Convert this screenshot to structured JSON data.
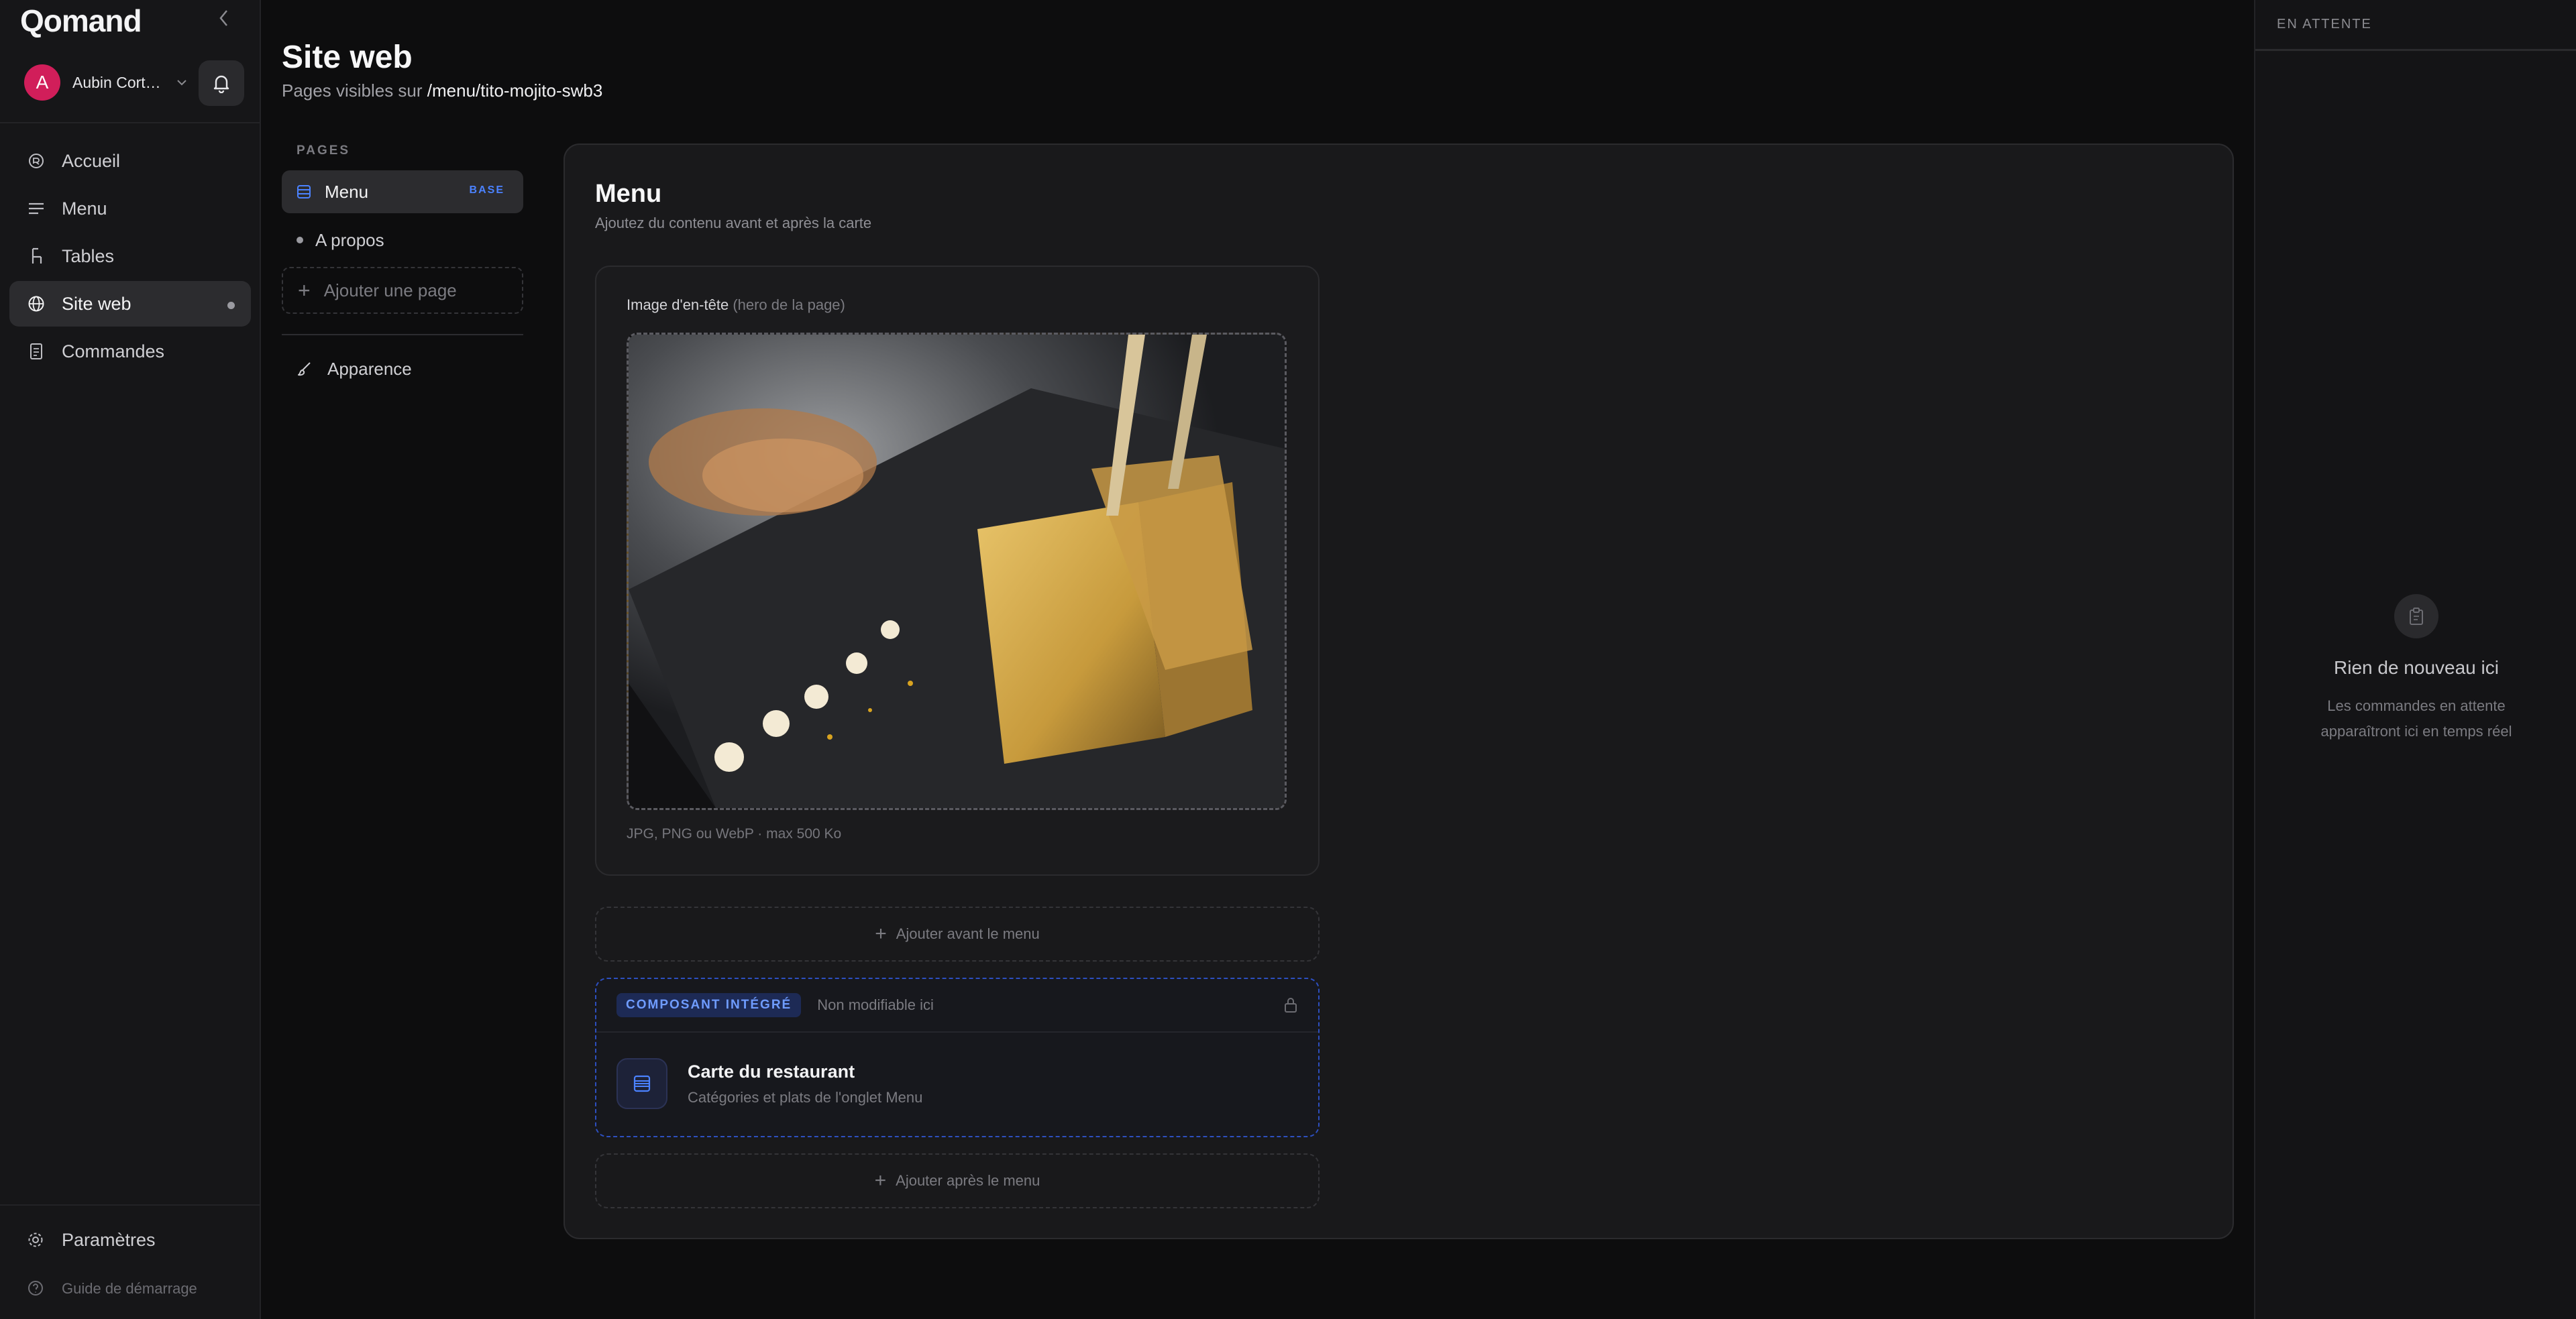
{
  "app": {
    "logo": "Qomand"
  },
  "user": {
    "initial": "A",
    "name": "Aubin Cort…"
  },
  "nav": {
    "items": [
      {
        "label": "Accueil",
        "icon": "home-circle-icon"
      },
      {
        "label": "Menu",
        "icon": "lines-icon"
      },
      {
        "label": "Tables",
        "icon": "chair-icon"
      },
      {
        "label": "Site web",
        "icon": "globe-icon"
      },
      {
        "label": "Commandes",
        "icon": "receipt-icon"
      }
    ],
    "settings": "Paramètres",
    "guide": "Guide de démarrage"
  },
  "header": {
    "title": "Site web",
    "subtitle_prefix": "Pages visibles sur ",
    "subtitle_path": "/menu/tito-mojito-swb3"
  },
  "pages": {
    "section_label": "PAGES",
    "items": [
      {
        "label": "Menu",
        "badge": "BASE"
      },
      {
        "label": "A propos"
      }
    ],
    "add_label": "Ajouter une page",
    "appearance_label": "Apparence"
  },
  "card": {
    "title": "Menu",
    "subtitle": "Ajoutez du contenu avant et après la carte",
    "hero": {
      "label": "Image d'en-tête",
      "label_hint": "(hero de la page)",
      "hint": "JPG, PNG ou WebP · max 500 Ko"
    },
    "add_before": "Ajouter avant le menu",
    "add_after": "Ajouter après le menu",
    "integrated": {
      "badge": "COMPOSANT INTÉGRÉ",
      "note": "Non modifiable ici",
      "title": "Carte du restaurant",
      "subtitle": "Catégories et plats de l'onglet Menu"
    }
  },
  "pending": {
    "header": "EN ATTENTE",
    "empty_title": "Rien de nouveau ici",
    "empty_text": "Les commandes en attente apparaîtront ici en temps réel"
  },
  "colors": {
    "accent": "#4b82ff",
    "avatar": "#d11e5a",
    "integrated_border": "#2d4fbf"
  }
}
